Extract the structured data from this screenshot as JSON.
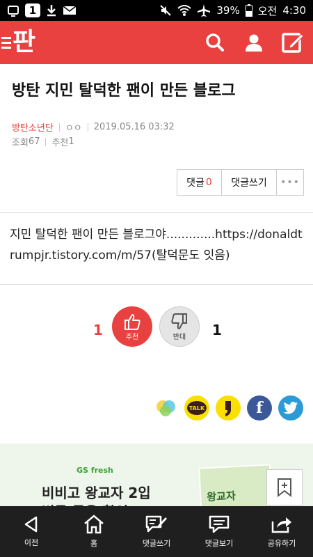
{
  "status_bar": {
    "notification_count": "1",
    "battery": "39%",
    "ampm": "오전",
    "time": "4:30"
  },
  "header": {
    "logo_text": "판"
  },
  "post": {
    "title": "방탄 지민 탈덕한 팬이 만든 블로그",
    "category": "방탄소년단",
    "author": "ㅇㅇ",
    "date": "2019.05.16 03:32",
    "views_label": "조회",
    "views": "67",
    "recommend_label": "추천",
    "recommend": "1",
    "content": "지민 탈덕한 팬이 만든 블로그야.............https://donaldtrumpjr.tistory.com/m/57(탈덕문도 잇음)"
  },
  "comment_buttons": {
    "comment_label": "댓글",
    "comment_count": "0",
    "write_label": "댓글쓰기",
    "more_label": "•••"
  },
  "vote": {
    "up_count": "1",
    "up_label": "추천",
    "down_label": "반대",
    "down_count": "1"
  },
  "share": {
    "kakaotalk_label": "TALK"
  },
  "ad": {
    "brand": "GS fresh",
    "line1": "비비고 왕교자 2입",
    "line2": "번들 묶음 할인",
    "package_label": "왕교자"
  },
  "bottom_nav": [
    {
      "label": "이전",
      "icon": "back-icon"
    },
    {
      "label": "홈",
      "icon": "home-icon"
    },
    {
      "label": "댓글쓰기",
      "icon": "write-comment-icon"
    },
    {
      "label": "댓글보기",
      "icon": "view-comments-icon"
    },
    {
      "label": "공유하기",
      "icon": "share-icon"
    }
  ],
  "colors": {
    "brand": "#e8413f",
    "bottom_bar": "#1f1f1f"
  }
}
